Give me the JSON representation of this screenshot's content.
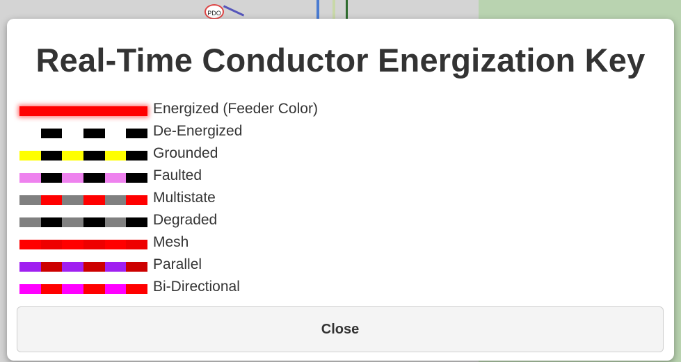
{
  "background": {
    "marker_label": "PDO"
  },
  "modal": {
    "title": "Real-Time Conductor Energization Key",
    "close_label": "Close",
    "legend": [
      {
        "label": "Energized (Feeder Color)",
        "pattern": [
          "#ff0000",
          "#ff0000",
          "#ff0000",
          "#ff0000",
          "#ff0000",
          "#ff0000"
        ],
        "glow": true
      },
      {
        "label": "De-Energized",
        "pattern": [
          "#ffffff",
          "#000000",
          "#ffffff",
          "#000000",
          "#ffffff",
          "#000000"
        ],
        "glow": false
      },
      {
        "label": "Grounded",
        "pattern": [
          "#ffff00",
          "#000000",
          "#ffff00",
          "#000000",
          "#ffff00",
          "#000000"
        ],
        "glow": false
      },
      {
        "label": "Faulted",
        "pattern": [
          "#ee82ee",
          "#000000",
          "#ee82ee",
          "#000000",
          "#ee82ee",
          "#000000"
        ],
        "glow": false
      },
      {
        "label": "Multistate",
        "pattern": [
          "#808080",
          "#ff0000",
          "#808080",
          "#ff0000",
          "#808080",
          "#ff0000"
        ],
        "glow": false
      },
      {
        "label": "Degraded",
        "pattern": [
          "#808080",
          "#000000",
          "#808080",
          "#000000",
          "#808080",
          "#000000"
        ],
        "glow": false
      },
      {
        "label": "Mesh",
        "pattern": [
          "#ff0000",
          "#ee0000",
          "#ff0000",
          "#ee0000",
          "#ff0000",
          "#ee0000"
        ],
        "glow": false
      },
      {
        "label": "Parallel",
        "pattern": [
          "#a020f0",
          "#cc0000",
          "#a020f0",
          "#cc0000",
          "#a020f0",
          "#cc0000"
        ],
        "glow": false
      },
      {
        "label": "Bi-Directional",
        "pattern": [
          "#ff00ff",
          "#ff0000",
          "#ff00ff",
          "#ff0000",
          "#ff00ff",
          "#ff0000"
        ],
        "glow": false
      }
    ]
  }
}
